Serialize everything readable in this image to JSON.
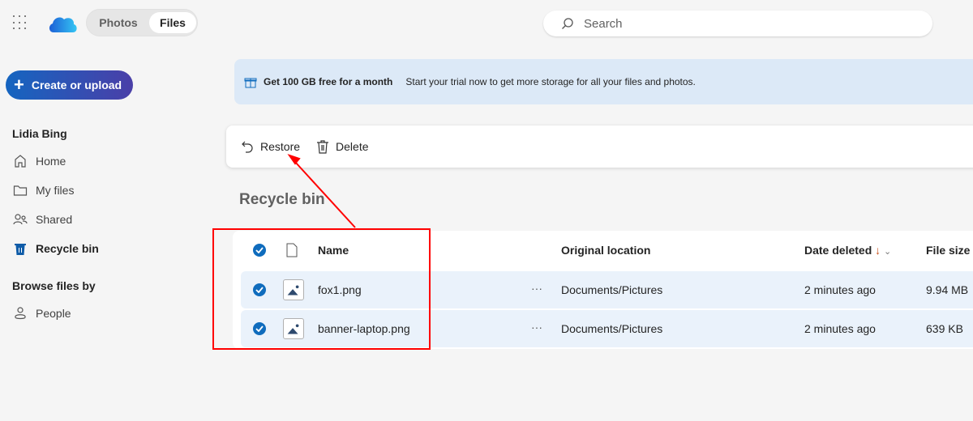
{
  "header": {
    "tabs": [
      {
        "label": "Photos",
        "active": false
      },
      {
        "label": "Files",
        "active": true
      }
    ],
    "search_placeholder": "Search"
  },
  "sidebar": {
    "create_label": "Create or upload",
    "user": "Lidia Bing",
    "items": [
      {
        "label": "Home",
        "icon": "home-icon"
      },
      {
        "label": "My files",
        "icon": "folder-icon"
      },
      {
        "label": "Shared",
        "icon": "people-icon"
      },
      {
        "label": "Recycle bin",
        "icon": "trash-icon",
        "active": true
      }
    ],
    "browse_heading": "Browse files by",
    "browse_items": [
      {
        "label": "People",
        "icon": "person-icon"
      }
    ]
  },
  "banner": {
    "title": "Get 100 GB free for a month",
    "text": "Start your trial now to get more storage for all your files and photos."
  },
  "toolbar": {
    "restore": "Restore",
    "delete": "Delete"
  },
  "page_title": "Recycle bin",
  "table": {
    "columns": {
      "name": "Name",
      "location": "Original location",
      "date": "Date deleted",
      "sort": "↓",
      "size": "File size"
    },
    "rows": [
      {
        "name": "fox1.png",
        "location": "Documents/Pictures",
        "date": "2 minutes ago",
        "size": "9.94 MB",
        "selected": true
      },
      {
        "name": "banner-laptop.png",
        "location": "Documents/Pictures",
        "date": "2 minutes ago",
        "size": "639 KB",
        "selected": true
      }
    ],
    "more": "···"
  },
  "colors": {
    "accent": "#0f6cbd",
    "annotation": "#ff0000",
    "row_selected": "#eaf2fb"
  }
}
